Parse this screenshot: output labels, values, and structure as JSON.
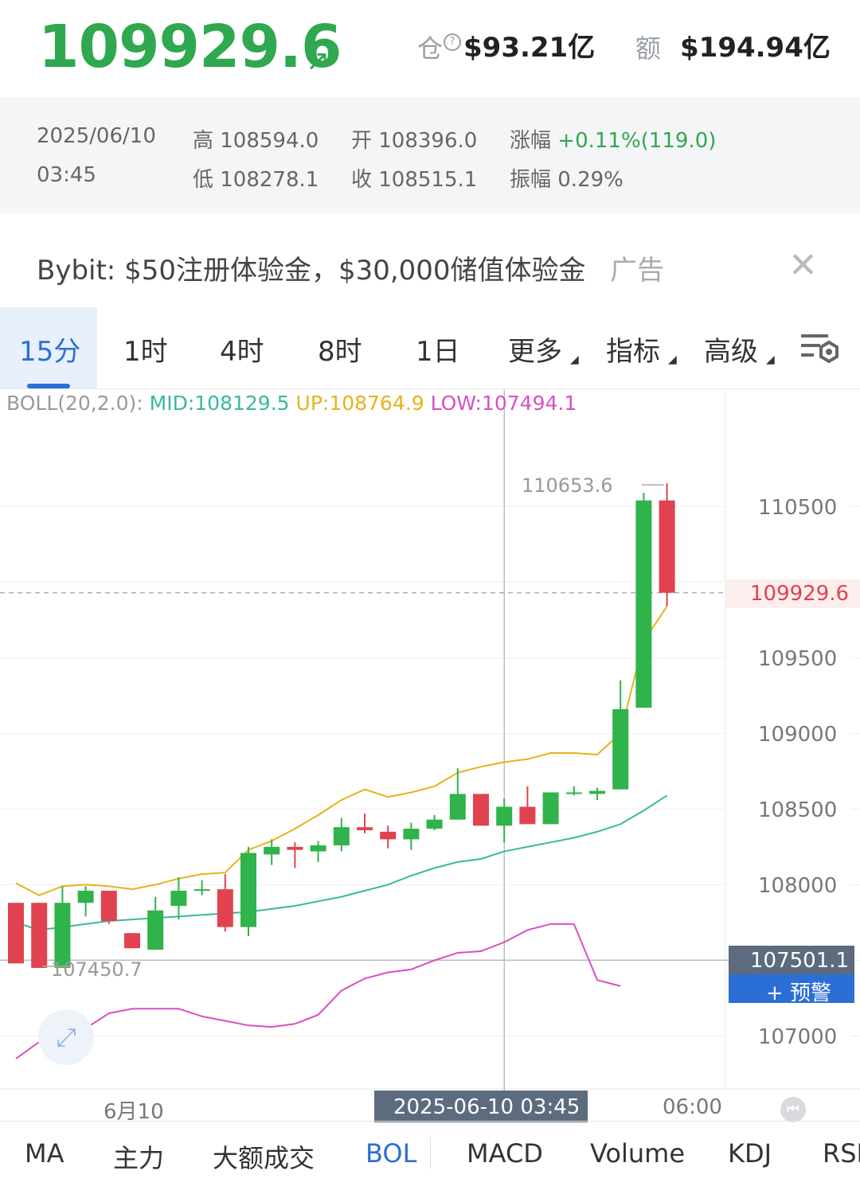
{
  "header": {
    "price": "109929.6",
    "arrow": "↗",
    "oi_label": "仓",
    "oi_value": "$93.21亿",
    "vol_label": "额",
    "vol_value": "$194.94亿"
  },
  "info": {
    "date": "2025/06/10",
    "time": "03:45",
    "high": "高 108594.0",
    "low": "低 108278.1",
    "open": "开 108396.0",
    "close": "收 108515.1",
    "change_label": "涨幅",
    "change_value": "+0.11%(119.0)",
    "amplitude": "振幅 0.29%"
  },
  "ad": {
    "text": "Bybit: $50注册体验金，$30,000储值体验金",
    "tag": "广告",
    "close": "✕"
  },
  "tabs": [
    {
      "label": "15分",
      "active": true
    },
    {
      "label": "1时"
    },
    {
      "label": "4时"
    },
    {
      "label": "8时"
    },
    {
      "label": "1日"
    },
    {
      "label": "更多"
    },
    {
      "label": "指标"
    },
    {
      "label": "高级"
    }
  ],
  "boll": {
    "label": "BOLL(20,2.0):",
    "mid": "MID:108129.5",
    "up": "UP:108764.9",
    "low": "LOW:107494.1"
  },
  "colors": {
    "up": "#2fb34a",
    "down": "#e0434f",
    "mid": "#37b9a0",
    "upper": "#e7b21b",
    "lower": "#d94fc1",
    "accent": "#2b6fd6"
  },
  "chart_data": {
    "type": "candlestick",
    "y_ticks": [
      "110500",
      "109500",
      "109000",
      "108500",
      "108000",
      "107000"
    ],
    "ylim": [
      106650,
      111480
    ],
    "current_price": "109929.6",
    "crosshair_price": "107501.1",
    "alert_label": "+ 预警",
    "max_label": "110653.6",
    "min_label": "107450.7",
    "x_labels": [
      "6月10",
      "06:00"
    ],
    "crosshair_time": "2025-06-10 03:45",
    "candles": [
      {
        "o": 107880,
        "h": 107880,
        "l": 107480,
        "c": 107480
      },
      {
        "o": 107880,
        "h": 107880,
        "l": 107450,
        "c": 107450
      },
      {
        "o": 107450,
        "h": 107990,
        "l": 107450,
        "c": 107880
      },
      {
        "o": 107880,
        "h": 107990,
        "l": 107790,
        "c": 107960
      },
      {
        "o": 107960,
        "h": 107960,
        "l": 107740,
        "c": 107760
      },
      {
        "o": 107680,
        "h": 107680,
        "l": 107580,
        "c": 107580
      },
      {
        "o": 107570,
        "h": 107920,
        "l": 107570,
        "c": 107830
      },
      {
        "o": 107860,
        "h": 108050,
        "l": 107770,
        "c": 107960
      },
      {
        "o": 107970,
        "h": 108030,
        "l": 107930,
        "c": 107970
      },
      {
        "o": 107970,
        "h": 108070,
        "l": 107690,
        "c": 107720
      },
      {
        "o": 107720,
        "h": 108250,
        "l": 107660,
        "c": 108210
      },
      {
        "o": 108200,
        "h": 108300,
        "l": 108130,
        "c": 108250
      },
      {
        "o": 108250,
        "h": 108280,
        "l": 108110,
        "c": 108230
      },
      {
        "o": 108220,
        "h": 108290,
        "l": 108150,
        "c": 108260
      },
      {
        "o": 108260,
        "h": 108440,
        "l": 108220,
        "c": 108380
      },
      {
        "o": 108380,
        "h": 108470,
        "l": 108340,
        "c": 108360
      },
      {
        "o": 108350,
        "h": 108390,
        "l": 108240,
        "c": 108300
      },
      {
        "o": 108300,
        "h": 108410,
        "l": 108230,
        "c": 108370
      },
      {
        "o": 108370,
        "h": 108460,
        "l": 108360,
        "c": 108430
      },
      {
        "o": 108430,
        "h": 108770,
        "l": 108430,
        "c": 108600
      },
      {
        "o": 108600,
        "h": 108600,
        "l": 108390,
        "c": 108390
      },
      {
        "o": 108390,
        "h": 108570,
        "l": 108280,
        "c": 108515
      },
      {
        "o": 108515,
        "h": 108650,
        "l": 108400,
        "c": 108400
      },
      {
        "o": 108400,
        "h": 108610,
        "l": 108400,
        "c": 108610
      },
      {
        "o": 108610,
        "h": 108650,
        "l": 108590,
        "c": 108610
      },
      {
        "o": 108600,
        "h": 108640,
        "l": 108560,
        "c": 108620
      },
      {
        "o": 108630,
        "h": 109350,
        "l": 108630,
        "c": 109160
      },
      {
        "o": 109170,
        "h": 110590,
        "l": 109170,
        "c": 110540
      },
      {
        "o": 110540,
        "h": 110653.6,
        "l": 109840,
        "c": 109929.6
      }
    ],
    "boll_up": [
      108010,
      107930,
      107990,
      108000,
      107990,
      107970,
      108000,
      108040,
      108070,
      108080,
      108230,
      108290,
      108370,
      108460,
      108560,
      108630,
      108580,
      108610,
      108650,
      108740,
      108780,
      108810,
      108830,
      108870,
      108870,
      108860,
      109000,
      109610,
      109840
    ],
    "boll_mid": [
      107750,
      107700,
      107720,
      107740,
      107760,
      107770,
      107780,
      107790,
      107800,
      107810,
      107820,
      107840,
      107860,
      107890,
      107920,
      107960,
      108000,
      108060,
      108110,
      108150,
      108170,
      108220,
      108250,
      108280,
      108310,
      108350,
      108400,
      108490,
      108590
    ],
    "boll_low": [
      106850,
      106960,
      106990,
      107050,
      107150,
      107180,
      107180,
      107180,
      107130,
      107100,
      107070,
      107060,
      107080,
      107140,
      107300,
      107380,
      107420,
      107440,
      107500,
      107550,
      107560,
      107620,
      107700,
      107740,
      107740,
      107370,
      107330
    ]
  },
  "indicators": [
    {
      "label": "MA"
    },
    {
      "label": "主力"
    },
    {
      "label": "大额成交"
    },
    {
      "label": "BOL",
      "active": true
    },
    {
      "label": "MACD"
    },
    {
      "label": "Volume"
    },
    {
      "label": "KDJ"
    },
    {
      "label": "RSI"
    }
  ]
}
